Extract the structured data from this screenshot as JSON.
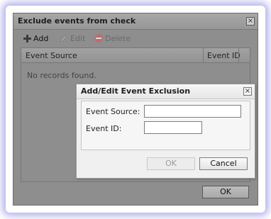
{
  "window": {
    "title": "Exclude events from check",
    "close_glyph": "×"
  },
  "toolbar": {
    "add_label": "Add",
    "edit_label": "Edit",
    "delete_label": "Delete"
  },
  "grid": {
    "columns": [
      "Event Source",
      "Event ID"
    ],
    "empty_text": "No records found."
  },
  "footer": {
    "ok_label": "OK"
  },
  "dialog": {
    "title": "Add/Edit Event Exclusion",
    "close_glyph": "×",
    "event_source_label": "Event Source:",
    "event_source_value": "",
    "event_id_label": "Event ID:",
    "event_id_value": "",
    "ok_label": "OK",
    "cancel_label": "Cancel"
  },
  "colors": {
    "frame_glow": "#7878dc",
    "delete_icon": "#b86f6f"
  }
}
